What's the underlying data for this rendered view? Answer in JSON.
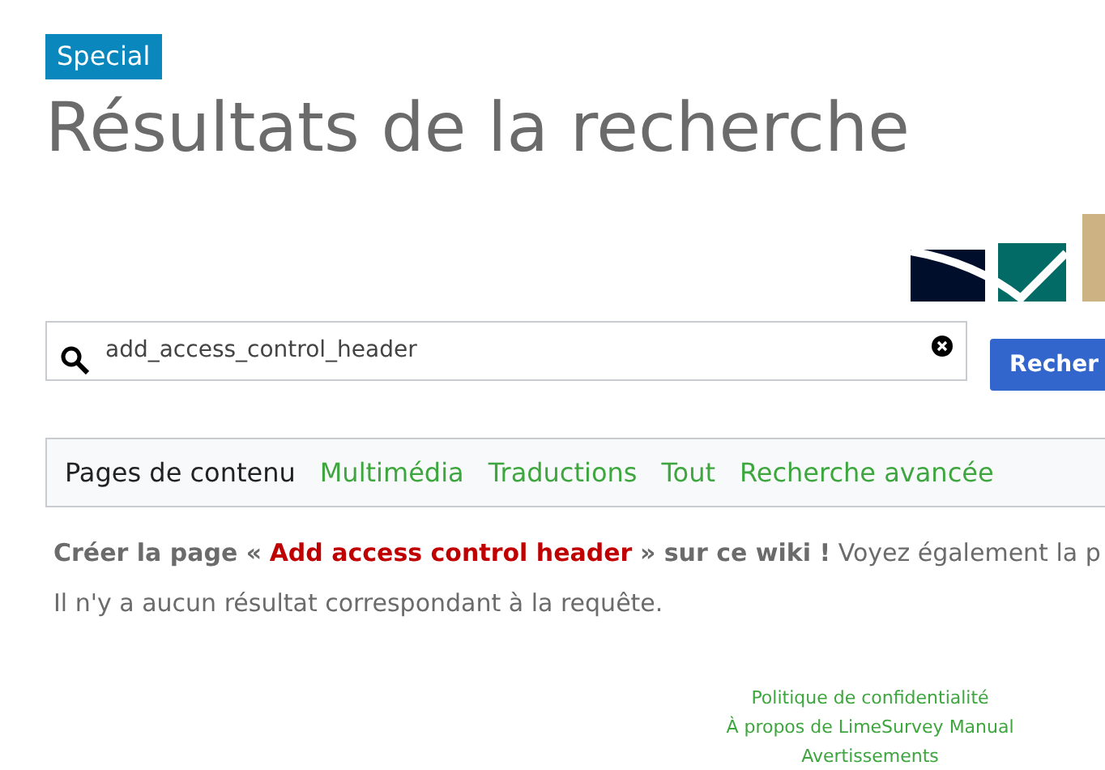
{
  "badge": "Special",
  "title": "Résultats de la recherche",
  "search": {
    "value": "add_access_control_header",
    "button": "Recher"
  },
  "tabs": [
    {
      "label": "Pages de contenu",
      "selected": true
    },
    {
      "label": "Multimédia",
      "selected": false
    },
    {
      "label": "Traductions",
      "selected": false
    },
    {
      "label": "Tout",
      "selected": false
    },
    {
      "label": "Recherche avancée",
      "selected": false
    }
  ],
  "message": {
    "before": "**Créer la page «**",
    "link": "Add access control header",
    "after": "**» sur ce wiki !** Voyez également la p"
  },
  "no_results": "Il n'y a aucun résultat correspondant à la requête.",
  "footer_links": [
    "Politique de confidentialité",
    "À propos de LimeSurvey Manual",
    "Avertissements"
  ]
}
